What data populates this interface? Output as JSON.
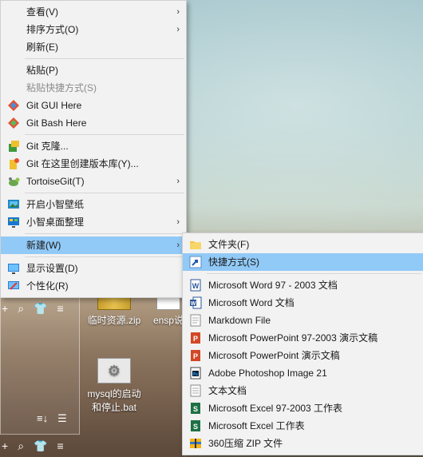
{
  "desktop": {
    "icons": [
      {
        "label": "临时资源.zip"
      },
      {
        "label": "ensp说"
      },
      {
        "label": "mysql的启动\n和停止.bat"
      }
    ]
  },
  "context_menu": {
    "items": [
      {
        "label": "查看(V)",
        "submenu": true
      },
      {
        "label": "排序方式(O)",
        "submenu": true
      },
      {
        "label": "刷新(E)"
      },
      {
        "label": "粘贴(P)"
      },
      {
        "label": "粘贴快捷方式(S)",
        "disabled": true
      },
      {
        "label": "Git GUI Here"
      },
      {
        "label": "Git Bash Here"
      },
      {
        "label": "Git 克隆..."
      },
      {
        "label": "Git 在这里创建版本库(Y)..."
      },
      {
        "label": "TortoiseGit(T)",
        "submenu": true
      },
      {
        "label": "开启小智壁纸"
      },
      {
        "label": "小智桌面整理",
        "submenu": true
      },
      {
        "label": "新建(W)",
        "submenu": true
      },
      {
        "label": "显示设置(D)"
      },
      {
        "label": "个性化(R)"
      }
    ]
  },
  "new_submenu": {
    "items": [
      {
        "label": "文件夹(F)",
        "icon": "folder-icon"
      },
      {
        "label": "快捷方式(S)",
        "icon": "shortcut-icon"
      },
      {
        "label": "Microsoft Word 97 - 2003 文档",
        "icon": "word-icon"
      },
      {
        "label": "Microsoft Word 文档",
        "icon": "word-icon"
      },
      {
        "label": "Markdown File",
        "icon": "markdown-icon"
      },
      {
        "label": "Microsoft PowerPoint 97-2003 演示文稿",
        "icon": "powerpoint-icon"
      },
      {
        "label": "Microsoft PowerPoint 演示文稿",
        "icon": "powerpoint-icon"
      },
      {
        "label": "Adobe Photoshop Image 21",
        "icon": "photoshop-icon"
      },
      {
        "label": "文本文档",
        "icon": "text-file-icon"
      },
      {
        "label": "Microsoft Excel 97-2003 工作表",
        "icon": "excel-icon"
      },
      {
        "label": "Microsoft Excel 工作表",
        "icon": "excel-icon"
      },
      {
        "label": "360压缩 ZIP 文件",
        "icon": "zip-icon"
      }
    ]
  }
}
